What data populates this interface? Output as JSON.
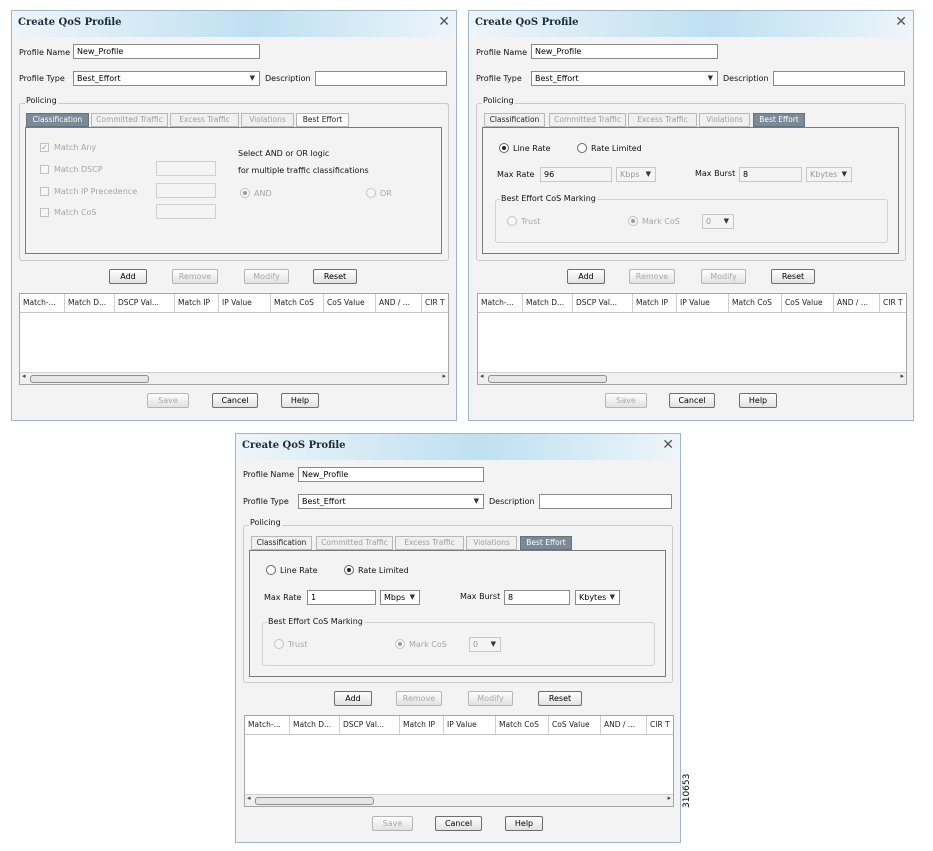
{
  "dialog": {
    "title": "Create QoS Profile",
    "profile_name_label": "Profile Name",
    "profile_name_value": "New_Profile",
    "profile_type_label": "Profile Type",
    "profile_type_value": "Best_Effort",
    "description_label": "Description",
    "description_value": "",
    "policing_label": "Policing",
    "tabs": [
      "Classification",
      "Committed Traffic",
      "Excess Traffic",
      "Violations",
      "Best Effort"
    ],
    "buttons": {
      "add": "Add",
      "remove": "Remove",
      "modify": "Modify",
      "reset": "Reset"
    },
    "footer": {
      "save": "Save",
      "cancel": "Cancel",
      "help": "Help"
    },
    "columns": [
      "Match-...",
      "Match D...",
      "DSCP Val...",
      "Match IP",
      "IP Value",
      "Match CoS",
      "CoS Value",
      "AND / ...",
      "CIR T"
    ]
  },
  "classification": {
    "match_any": "Match Any",
    "match_dscp": "Match DSCP",
    "match_ip_precedence": "Match IP Precedence",
    "match_cos": "Match CoS",
    "logic_line1": "Select AND or OR logic",
    "logic_line2": "for multiple traffic classifications",
    "and_label": "AND",
    "or_label": "OR"
  },
  "best_effort_line_rate": {
    "line_rate": "Line Rate",
    "rate_limited": "Rate Limited",
    "max_rate_label": "Max Rate",
    "max_rate_value": "96",
    "max_rate_unit": "Kbps",
    "max_burst_label": "Max Burst",
    "max_burst_value": "8",
    "max_burst_unit": "Kbytes",
    "cos_marking_label": "Best Effort CoS Marking",
    "trust_label": "Trust",
    "mark_cos_label": "Mark CoS",
    "mark_cos_value": "0"
  },
  "best_effort_rate_limited": {
    "line_rate": "Line Rate",
    "rate_limited": "Rate Limited",
    "max_rate_label": "Max Rate",
    "max_rate_value": "1",
    "max_rate_unit": "Mbps",
    "max_burst_label": "Max Burst",
    "max_burst_value": "8",
    "max_burst_unit": "Kbytes",
    "cos_marking_label": "Best Effort CoS Marking",
    "trust_label": "Trust",
    "mark_cos_label": "Mark CoS",
    "mark_cos_value": "0"
  },
  "figure_number": "310653",
  "colors": {
    "title_gradient": "#bfe0f0",
    "active_tab": "#7a8a97",
    "background": "#f3f3f3"
  }
}
